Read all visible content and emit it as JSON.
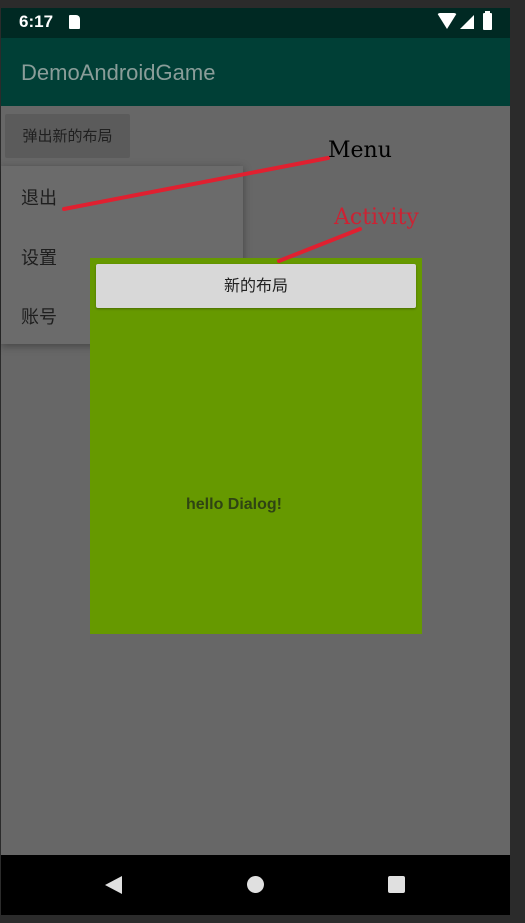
{
  "status_bar": {
    "time": "6:17",
    "icons": [
      "sd-card-icon",
      "wifi-icon",
      "signal-icon",
      "battery-icon"
    ]
  },
  "app_bar": {
    "title": "DemoAndroidGame"
  },
  "main": {
    "popup_button_label": "弹出新的布局"
  },
  "menu": {
    "items": [
      {
        "label": "退出"
      },
      {
        "label": "设置"
      },
      {
        "label": "账号"
      }
    ]
  },
  "dialog": {
    "button_label": "新的布局",
    "message": "hello Dialog!"
  },
  "nav_bar": {
    "icons": [
      "back-icon",
      "home-icon",
      "recents-icon"
    ]
  },
  "annotations": [
    {
      "label": "Menu",
      "color": "#000000"
    },
    {
      "label": "Activity",
      "color": "#cc2233"
    }
  ],
  "colors": {
    "status_bar": "#002923",
    "app_bar": "#003f36",
    "dialog_background": "#669900",
    "annotation_line": "#e02030"
  }
}
